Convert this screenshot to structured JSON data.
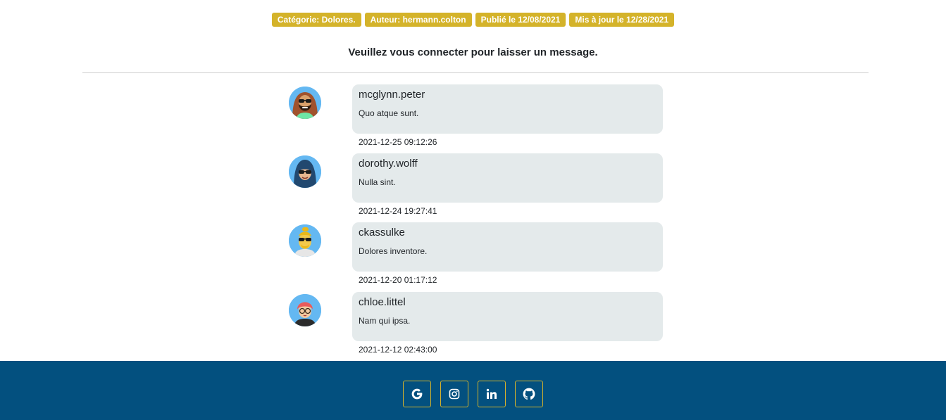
{
  "post_meta": {
    "category": "Catégorie: Dolores.",
    "author": "Auteur: hermann.colton",
    "published": "Publié le 12/08/2021",
    "updated": "Mis à jour le 12/28/2021"
  },
  "login_message": "Veuillez vous connecter pour laisser un message.",
  "comments": [
    {
      "username": "mcglynn.peter",
      "message": "Quo atque sunt.",
      "date": "2021-12-25 09:12:26",
      "avatar": "bearded-man-sunglasses-avatar"
    },
    {
      "username": "dorothy.wolff",
      "message": "Nulla sint.",
      "date": "2021-12-24 19:27:41",
      "avatar": "hijab-woman-sunglasses-avatar"
    },
    {
      "username": "ckassulke",
      "message": "Dolores inventore.",
      "date": "2021-12-20 01:17:12",
      "avatar": "blond-man-sunglasses-avatar"
    },
    {
      "username": "chloe.littel",
      "message": "Nam qui ipsa.",
      "date": "2021-12-12 02:43:00",
      "avatar": "red-hair-woman-glasses-avatar"
    }
  ],
  "footer": {
    "socials": [
      "google-icon",
      "instagram-icon",
      "linkedin-icon",
      "github-icon"
    ]
  },
  "colors": {
    "badge": "#d4b32a",
    "bubble": "#e4eaeb",
    "footer": "#03507f",
    "avatar_bg": "#64b8f2"
  }
}
